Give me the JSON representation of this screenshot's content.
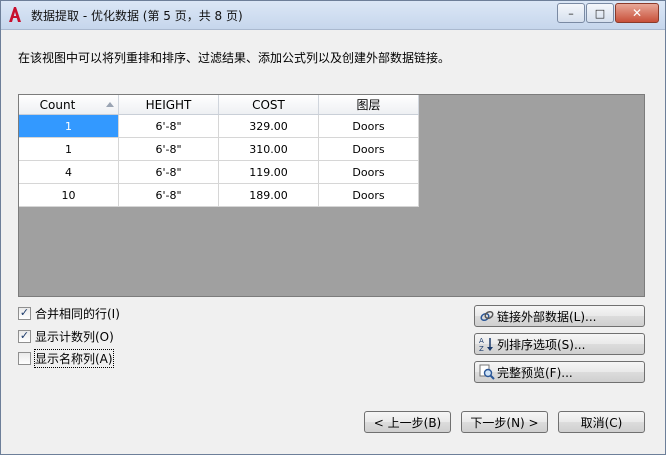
{
  "window": {
    "title": "数据提取 - 优化数据 (第 5 页，共 8 页)",
    "minimize_glyph": "–",
    "maximize_glyph": "□",
    "close_glyph": "✕"
  },
  "instruction": "在该视图中可以将列重排和排序、过滤结果、添加公式列以及创建外部数据链接。",
  "grid": {
    "headers": [
      "Count",
      "HEIGHT",
      "COST",
      "图层"
    ],
    "rows": [
      [
        "1",
        "6'-8\"",
        "329.00",
        "Doors"
      ],
      [
        "1",
        "6'-8\"",
        "310.00",
        "Doors"
      ],
      [
        "4",
        "6'-8\"",
        "119.00",
        "Doors"
      ],
      [
        "10",
        "6'-8\"",
        "189.00",
        "Doors"
      ]
    ],
    "selected_color": "#3399ff"
  },
  "options": {
    "merge_rows": {
      "label": "合并相同的行(I)",
      "checked": true
    },
    "show_count": {
      "label": "显示计数列(O)",
      "checked": true
    },
    "show_name": {
      "label": "显示名称列(A)",
      "checked": false
    }
  },
  "side_buttons": {
    "link_external": "链接外部数据(L)...",
    "sort_options": "列排序选项(S)...",
    "full_preview": "完整预览(F)..."
  },
  "nav_buttons": {
    "back": "< 上一步(B)",
    "next": "下一步(N) >",
    "cancel": "取消(C)"
  },
  "icons": {
    "app": "autocad-a-icon",
    "link": "link-external-icon",
    "sort": "sort-az-icon",
    "preview": "magnifier-preview-icon"
  }
}
